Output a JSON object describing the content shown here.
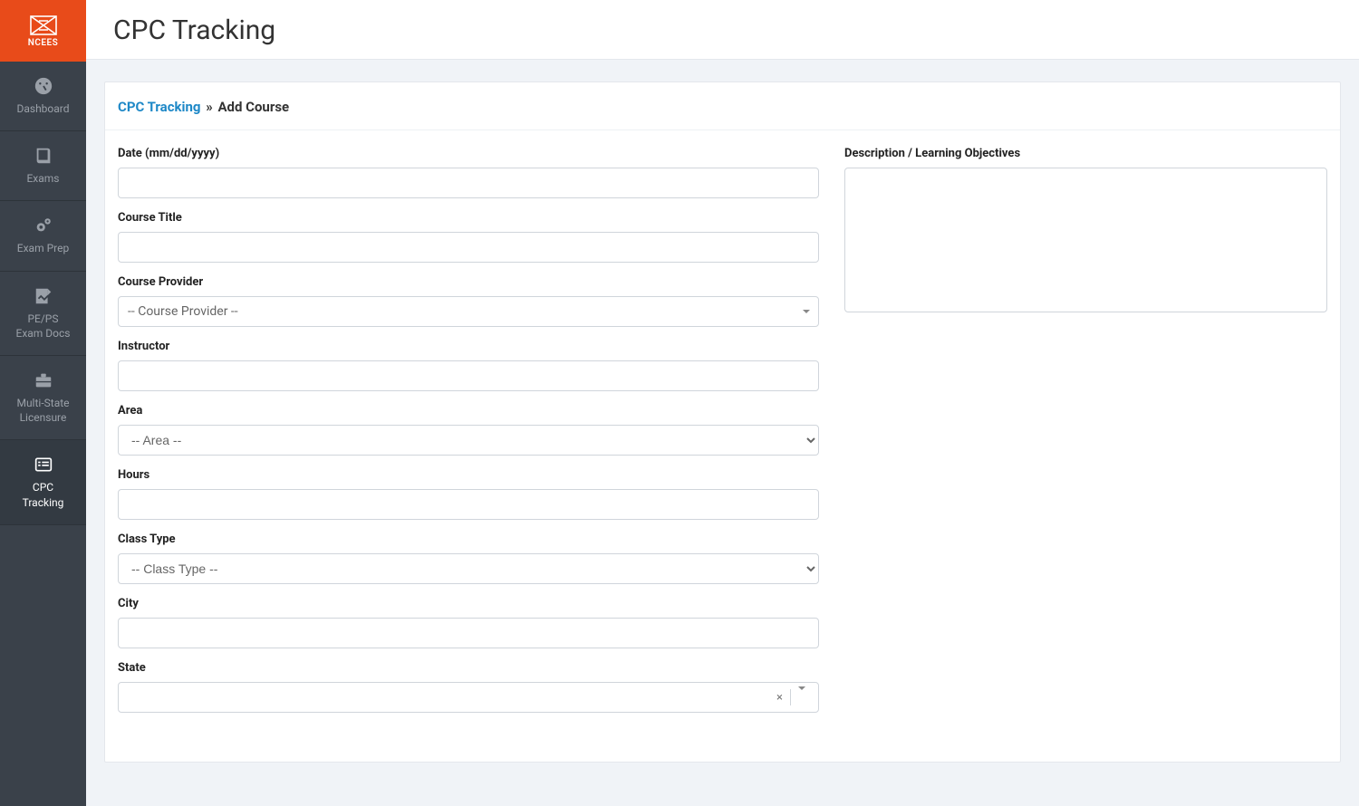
{
  "brand": {
    "text": "NCEES"
  },
  "header": {
    "title": "CPC Tracking"
  },
  "sidebar": {
    "items": [
      {
        "label": "Dashboard",
        "icon": "dashboard-icon"
      },
      {
        "label": "Exams",
        "icon": "book-icon"
      },
      {
        "label": "Exam Prep",
        "icon": "gears-icon"
      },
      {
        "label": "PE/PS\nExam Docs",
        "icon": "signature-icon"
      },
      {
        "label": "Multi-State\nLicensure",
        "icon": "briefcase-icon"
      },
      {
        "label": "CPC\nTracking",
        "icon": "list-icon"
      }
    ],
    "active_index": 5
  },
  "breadcrumb": {
    "root": "CPC Tracking",
    "separator": "»",
    "current": "Add Course"
  },
  "form": {
    "date": {
      "label": "Date (mm/dd/yyyy)",
      "value": ""
    },
    "course_title": {
      "label": "Course Title",
      "value": ""
    },
    "course_provider": {
      "label": "Course Provider",
      "placeholder": "-- Course Provider --",
      "value": ""
    },
    "instructor": {
      "label": "Instructor",
      "value": ""
    },
    "area": {
      "label": "Area",
      "placeholder": "-- Area --",
      "value": ""
    },
    "hours": {
      "label": "Hours",
      "value": ""
    },
    "class_type": {
      "label": "Class Type",
      "placeholder": "-- Class Type --",
      "value": ""
    },
    "city": {
      "label": "City",
      "value": ""
    },
    "state": {
      "label": "State",
      "value": ""
    },
    "description": {
      "label": "Description / Learning Objectives",
      "value": ""
    }
  }
}
